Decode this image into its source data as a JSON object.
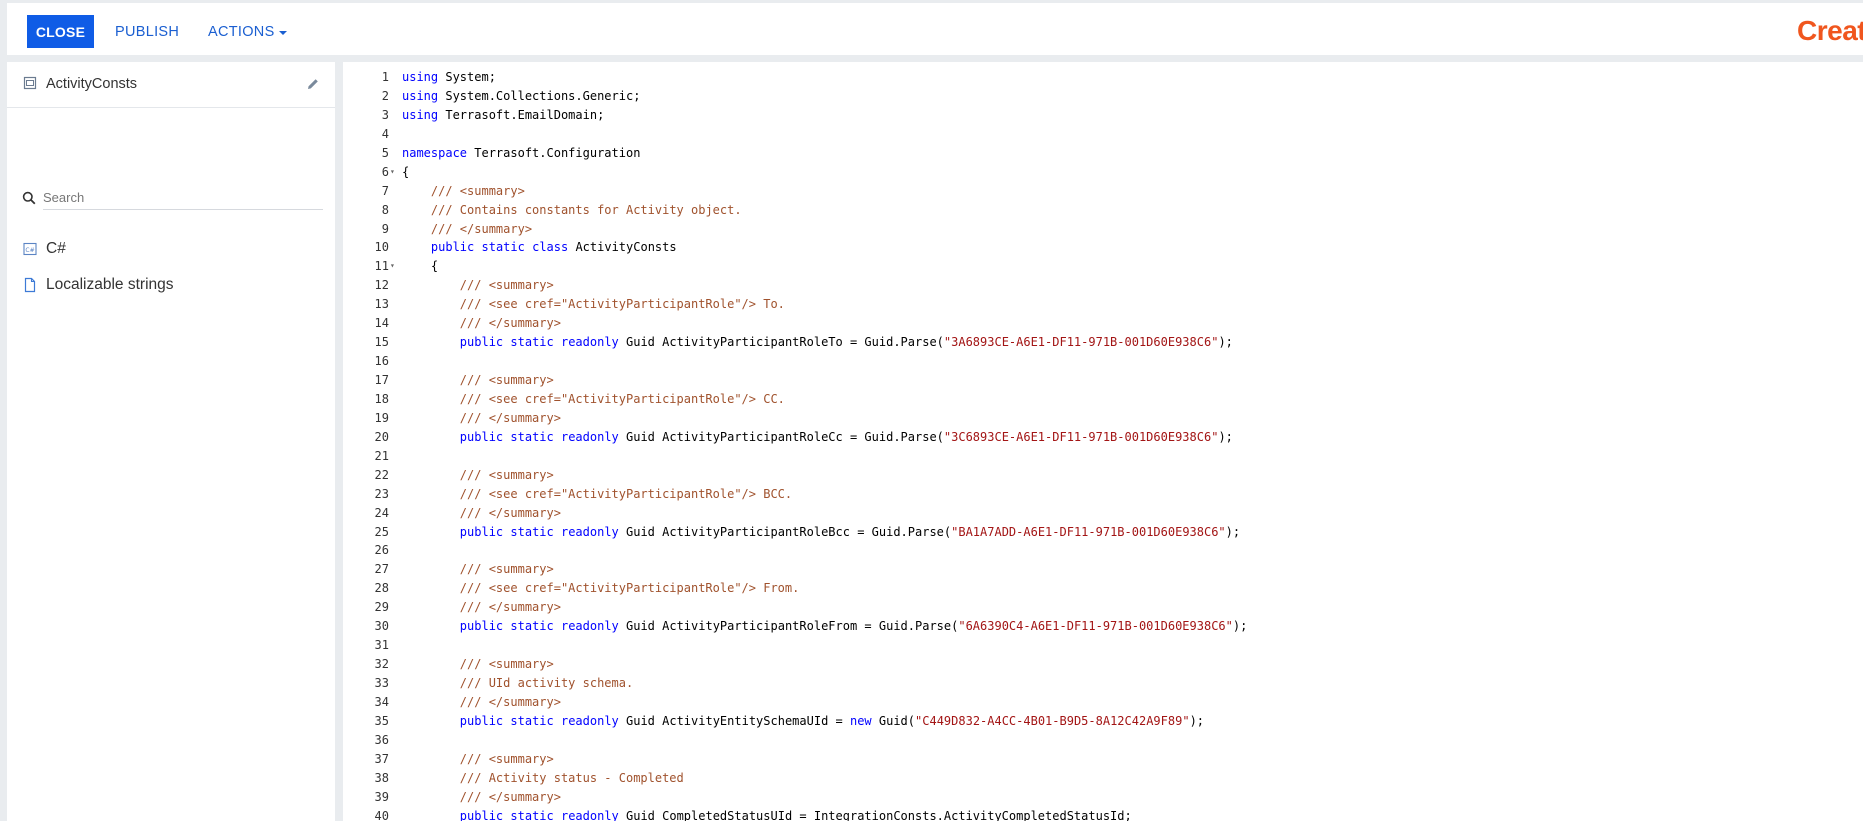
{
  "toolbar": {
    "close_label": "CLOSE",
    "publish_label": "PUBLISH",
    "actions_label": "ACTIONS"
  },
  "brand": {
    "logo_text": "Creatio",
    "accent_color": "#0f5ce6",
    "logo_color": "#f0561e"
  },
  "sidebar": {
    "schema_name": "ActivityConsts",
    "schema_icon": "schema-file-icon",
    "edit_icon": "pencil-icon",
    "search": {
      "placeholder": "Search",
      "icon": "search-icon"
    },
    "items": [
      {
        "label": "C#",
        "icon": "csharp-file-icon"
      },
      {
        "label": "Localizable strings",
        "icon": "document-icon"
      }
    ]
  },
  "editor": {
    "language": "C#",
    "colors": {
      "keyword": "#0000ff",
      "comment": "#a0522d",
      "string": "#a31515"
    },
    "lines": [
      {
        "n": "1",
        "fold": false,
        "text": "using System;"
      },
      {
        "n": "2",
        "fold": false,
        "text": "using System.Collections.Generic;"
      },
      {
        "n": "3",
        "fold": false,
        "text": "using Terrasoft.EmailDomain;"
      },
      {
        "n": "4",
        "fold": false,
        "text": ""
      },
      {
        "n": "5",
        "fold": false,
        "text": "namespace Terrasoft.Configuration"
      },
      {
        "n": "6",
        "fold": true,
        "text": "{"
      },
      {
        "n": "7",
        "fold": false,
        "text": "    /// <summary>"
      },
      {
        "n": "8",
        "fold": false,
        "text": "    /// Contains constants for Activity object."
      },
      {
        "n": "9",
        "fold": false,
        "text": "    /// </summary>"
      },
      {
        "n": "10",
        "fold": false,
        "text": "    public static class ActivityConsts"
      },
      {
        "n": "11",
        "fold": true,
        "text": "    {"
      },
      {
        "n": "12",
        "fold": false,
        "text": "        /// <summary>"
      },
      {
        "n": "13",
        "fold": false,
        "text": "        /// <see cref=\"ActivityParticipantRole\"/> To."
      },
      {
        "n": "14",
        "fold": false,
        "text": "        /// </summary>"
      },
      {
        "n": "15",
        "fold": false,
        "text": "        public static readonly Guid ActivityParticipantRoleTo = Guid.Parse(\"3A6893CE-A6E1-DF11-971B-001D60E938C6\");"
      },
      {
        "n": "16",
        "fold": false,
        "text": ""
      },
      {
        "n": "17",
        "fold": false,
        "text": "        /// <summary>"
      },
      {
        "n": "18",
        "fold": false,
        "text": "        /// <see cref=\"ActivityParticipantRole\"/> CC."
      },
      {
        "n": "19",
        "fold": false,
        "text": "        /// </summary>"
      },
      {
        "n": "20",
        "fold": false,
        "text": "        public static readonly Guid ActivityParticipantRoleCc = Guid.Parse(\"3C6893CE-A6E1-DF11-971B-001D60E938C6\");"
      },
      {
        "n": "21",
        "fold": false,
        "text": ""
      },
      {
        "n": "22",
        "fold": false,
        "text": "        /// <summary>"
      },
      {
        "n": "23",
        "fold": false,
        "text": "        /// <see cref=\"ActivityParticipantRole\"/> BCC."
      },
      {
        "n": "24",
        "fold": false,
        "text": "        /// </summary>"
      },
      {
        "n": "25",
        "fold": false,
        "text": "        public static readonly Guid ActivityParticipantRoleBcc = Guid.Parse(\"BA1A7ADD-A6E1-DF11-971B-001D60E938C6\");"
      },
      {
        "n": "26",
        "fold": false,
        "text": ""
      },
      {
        "n": "27",
        "fold": false,
        "text": "        /// <summary>"
      },
      {
        "n": "28",
        "fold": false,
        "text": "        /// <see cref=\"ActivityParticipantRole\"/> From."
      },
      {
        "n": "29",
        "fold": false,
        "text": "        /// </summary>"
      },
      {
        "n": "30",
        "fold": false,
        "text": "        public static readonly Guid ActivityParticipantRoleFrom = Guid.Parse(\"6A6390C4-A6E1-DF11-971B-001D60E938C6\");"
      },
      {
        "n": "31",
        "fold": false,
        "text": ""
      },
      {
        "n": "32",
        "fold": false,
        "text": "        /// <summary>"
      },
      {
        "n": "33",
        "fold": false,
        "text": "        /// UId activity schema."
      },
      {
        "n": "34",
        "fold": false,
        "text": "        /// </summary>"
      },
      {
        "n": "35",
        "fold": false,
        "text": "        public static readonly Guid ActivityEntitySchemaUId = new Guid(\"C449D832-A4CC-4B01-B9D5-8A12C42A9F89\");"
      },
      {
        "n": "36",
        "fold": false,
        "text": ""
      },
      {
        "n": "37",
        "fold": false,
        "text": "        /// <summary>"
      },
      {
        "n": "38",
        "fold": false,
        "text": "        /// Activity status - Completed"
      },
      {
        "n": "39",
        "fold": false,
        "text": "        /// </summary>"
      },
      {
        "n": "40",
        "fold": false,
        "text": "        public static readonly Guid CompletedStatusUId = IntegrationConsts.ActivityCompletedStatusId;"
      }
    ]
  }
}
